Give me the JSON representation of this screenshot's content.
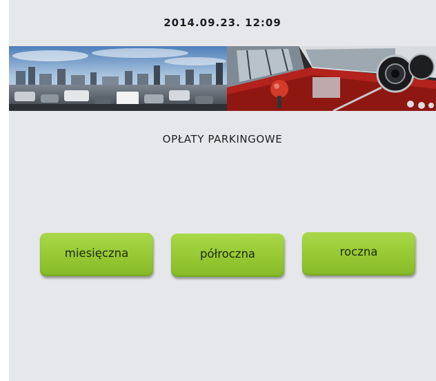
{
  "header": {
    "datetime": "2014.09.23. 12:09"
  },
  "banner": {
    "left_image": "city-traffic-photo",
    "right_image": "red-car-dashboard-photo"
  },
  "main": {
    "title": "OPŁATY PARKINGOWE",
    "buttons": [
      {
        "label": "miesięczna"
      },
      {
        "label": "półroczna"
      },
      {
        "label": "roczna"
      }
    ]
  },
  "colors": {
    "background": "#e6e7ea",
    "button": "#95c832",
    "text": "#1e1e1e"
  }
}
